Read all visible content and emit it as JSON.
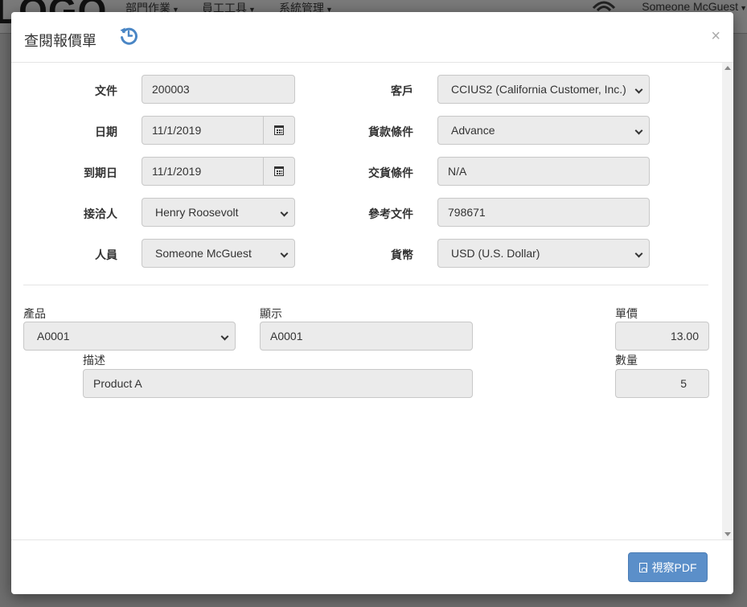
{
  "background": {
    "logo": "LOGO",
    "menus": [
      "部門作業",
      "員工工具",
      "系統管理"
    ],
    "user": "Someone McGuest"
  },
  "modal": {
    "title": "查閱報價單",
    "close": "×",
    "history_icon": "history-icon"
  },
  "header_form": {
    "document": {
      "label": "文件",
      "value": "200003"
    },
    "date": {
      "label": "日期",
      "value": "11/1/2019"
    },
    "due_date": {
      "label": "到期日",
      "value": "11/1/2019"
    },
    "contact": {
      "label": "接洽人",
      "value": "Henry Roosevolt"
    },
    "staff": {
      "label": "人員",
      "value": "Someone McGuest"
    },
    "customer": {
      "label": "客戶",
      "value": "CCIUS2 (California Customer, Inc.)"
    },
    "payment_terms": {
      "label": "貨款條件",
      "value": "Advance"
    },
    "delivery_terms": {
      "label": "交貨條件",
      "value": "N/A"
    },
    "reference": {
      "label": "參考文件",
      "value": "798671"
    },
    "currency": {
      "label": "貨幣",
      "value": "USD (U.S. Dollar)"
    }
  },
  "line_item": {
    "product": {
      "label": "產品",
      "value": "A0001"
    },
    "display": {
      "label": "顯示",
      "value": "A0001"
    },
    "unit_price": {
      "label": "單價",
      "value": "13.00"
    },
    "description": {
      "label": "描述",
      "value": "Product A"
    },
    "quantity": {
      "label": "數量",
      "value": "5"
    }
  },
  "footer": {
    "view_pdf": "視察PDF"
  },
  "colors": {
    "primary_button": "#5b8fc9",
    "history_icon": "#4a86c5"
  }
}
